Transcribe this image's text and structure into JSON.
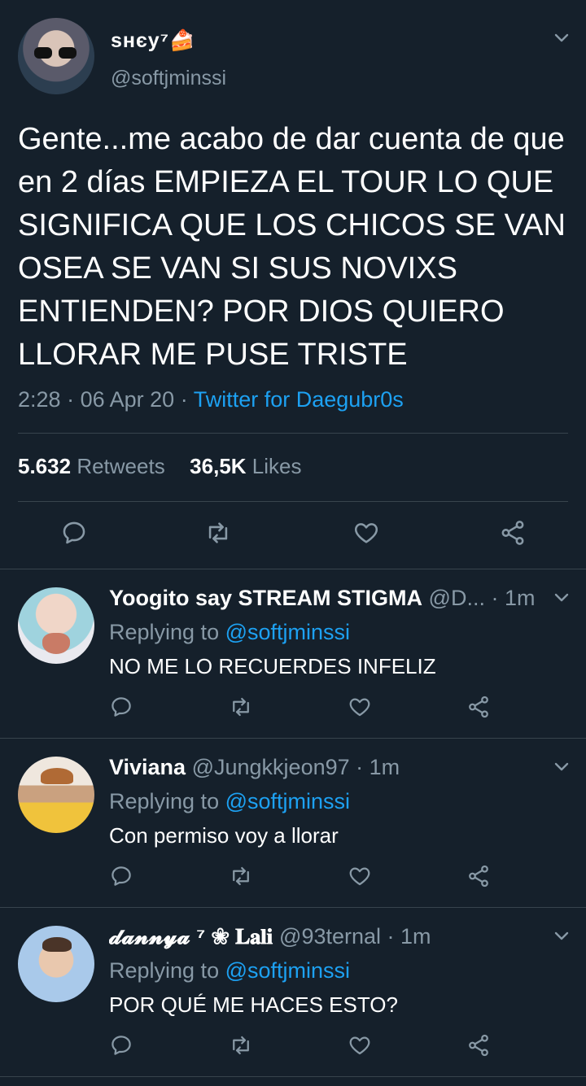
{
  "tweet": {
    "display_name": "ѕнєу⁷🍰",
    "handle": "@softjminssi",
    "text": "Gente...me acabo de dar cuenta de que en 2 días EMPIEZA EL TOUR LO QUE SIGNIFICA QUE LOS CHICOS SE VAN OSEA SE VAN SI SUS NOVIXS ENTIENDEN? POR DIOS QUIERO LLORAR ME PUSE TRISTE",
    "time": "2:28",
    "date": "06 Apr 20",
    "source": "Twitter for Daegubr0s",
    "retweet_count": "5.632",
    "retweet_label": "Retweets",
    "like_count": "36,5K",
    "like_label": "Likes"
  },
  "replies": [
    {
      "name": "Yoogito say STREAM STIGMA",
      "handle": "@D...",
      "age": "· 1m",
      "replying_label": "Replying to",
      "replying_to": "@softjminssi",
      "text": "NO ME LO RECUERDES INFELIZ"
    },
    {
      "name": "Viviana",
      "handle": "@Jungkkjeon97",
      "age": "· 1m",
      "replying_label": "Replying to",
      "replying_to": "@softjminssi",
      "text": "Con permiso voy a llorar"
    },
    {
      "name": "𝓭𝓪𝓷𝓷𝔂𝓪 ⁷ ❀ 𝐋𝐚𝐥𝐢",
      "handle": "@93ternal",
      "age": "· 1m",
      "replying_label": "Replying to",
      "replying_to": "@softjminssi",
      "text": "POR QUÉ ME HACES ESTO?"
    }
  ],
  "colors": {
    "background": "#15202b",
    "muted": "#8899a6",
    "link": "#1da1f2",
    "divider": "#38444d"
  },
  "icons": [
    "reply-icon",
    "retweet-icon",
    "like-icon",
    "share-icon",
    "chevron-down-icon"
  ]
}
